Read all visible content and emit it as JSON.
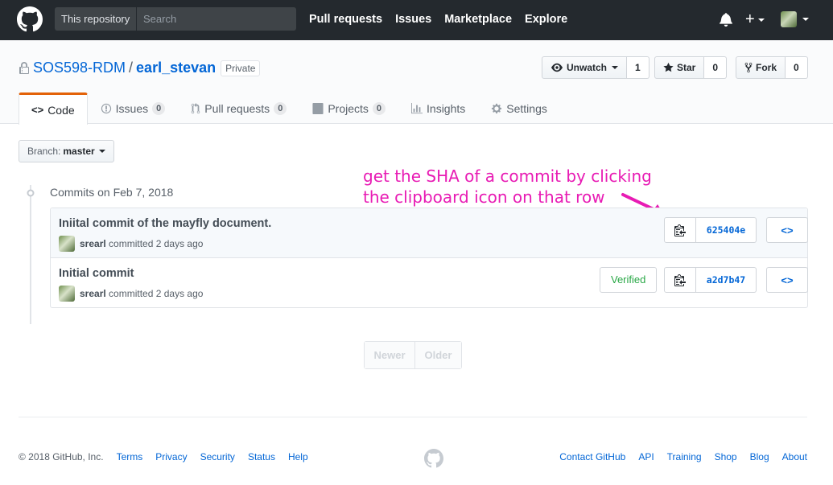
{
  "header": {
    "logo_icon": "github-octocat-icon",
    "scope_label": "This repository",
    "search_placeholder": "Search",
    "nav": [
      "Pull requests",
      "Issues",
      "Marketplace",
      "Explore"
    ],
    "notification_icon": "bell-icon",
    "new_icon": "plus-icon"
  },
  "repo": {
    "owner": "SOS598-RDM",
    "separator": "/",
    "name": "earl_stevan",
    "visibility": "Private",
    "actions": {
      "unwatch_label": "Unwatch",
      "unwatch_count": "1",
      "star_label": "Star",
      "star_count": "0",
      "fork_label": "Fork",
      "fork_count": "0"
    },
    "tabs": [
      {
        "label": "Code",
        "icon": "code-icon",
        "selected": true
      },
      {
        "label": "Issues",
        "icon": "issue-icon",
        "count": "0"
      },
      {
        "label": "Pull requests",
        "icon": "pull-request-icon",
        "count": "0"
      },
      {
        "label": "Projects",
        "icon": "project-icon",
        "count": "0"
      },
      {
        "label": "Insights",
        "icon": "graph-icon"
      },
      {
        "label": "Settings",
        "icon": "gear-icon"
      }
    ]
  },
  "branch": {
    "prefix": "Branch:",
    "name": "master"
  },
  "annotation": {
    "line1": "get the SHA of a commit by clicking",
    "line2": "the clipboard icon on that row",
    "color": "#e81bb4"
  },
  "commits": {
    "group_title": "Commits on Feb 7, 2018",
    "rows": [
      {
        "message": "Iniital commit of the mayfly document.",
        "author": "srearl",
        "when": "committed 2 days ago",
        "sha": "625404e",
        "verified": ""
      },
      {
        "message": "Initial commit",
        "author": "srearl",
        "when": "committed 2 days ago",
        "sha": "a2d7b47",
        "verified": "Verified"
      }
    ]
  },
  "pagination": {
    "newer": "Newer",
    "older": "Older"
  },
  "footer": {
    "copyright": "© 2018 GitHub, Inc.",
    "left_links": [
      "Terms",
      "Privacy",
      "Security",
      "Status",
      "Help"
    ],
    "right_links": [
      "Contact GitHub",
      "API",
      "Training",
      "Shop",
      "Blog",
      "About"
    ]
  },
  "colors": {
    "header_bg": "#24292e",
    "link": "#0366d6",
    "selected_tab_accent": "#e36209",
    "verified": "#28a745"
  }
}
